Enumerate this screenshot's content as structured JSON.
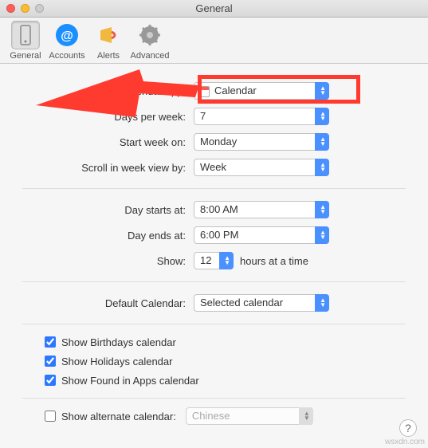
{
  "window": {
    "title": "General"
  },
  "toolbar": {
    "general": "General",
    "accounts": "Accounts",
    "alerts": "Alerts",
    "advanced": "Advanced"
  },
  "labels": {
    "default_app": "Default calendar app:",
    "days_per_week": "Days per week:",
    "start_week": "Start week on:",
    "scroll_week": "Scroll in week view by:",
    "day_starts": "Day starts at:",
    "day_ends": "Day ends at:",
    "show": "Show:",
    "hours_at_time": "hours at a time",
    "default_calendar": "Default Calendar:",
    "show_birthdays": "Show Birthdays calendar",
    "show_holidays": "Show Holidays calendar",
    "show_found_apps": "Show Found in Apps calendar",
    "show_alternate": "Show alternate calendar:"
  },
  "values": {
    "default_app": "Calendar",
    "days_per_week": "7",
    "start_week": "Monday",
    "scroll_week": "Week",
    "day_starts": "8:00 AM",
    "day_ends": "6:00 PM",
    "show_hours": "12",
    "default_calendar": "Selected calendar",
    "alternate_calendar": "Chinese"
  },
  "checks": {
    "birthdays": true,
    "holidays": true,
    "found_apps": true,
    "alternate": false
  },
  "watermark": "wsxdn.com"
}
